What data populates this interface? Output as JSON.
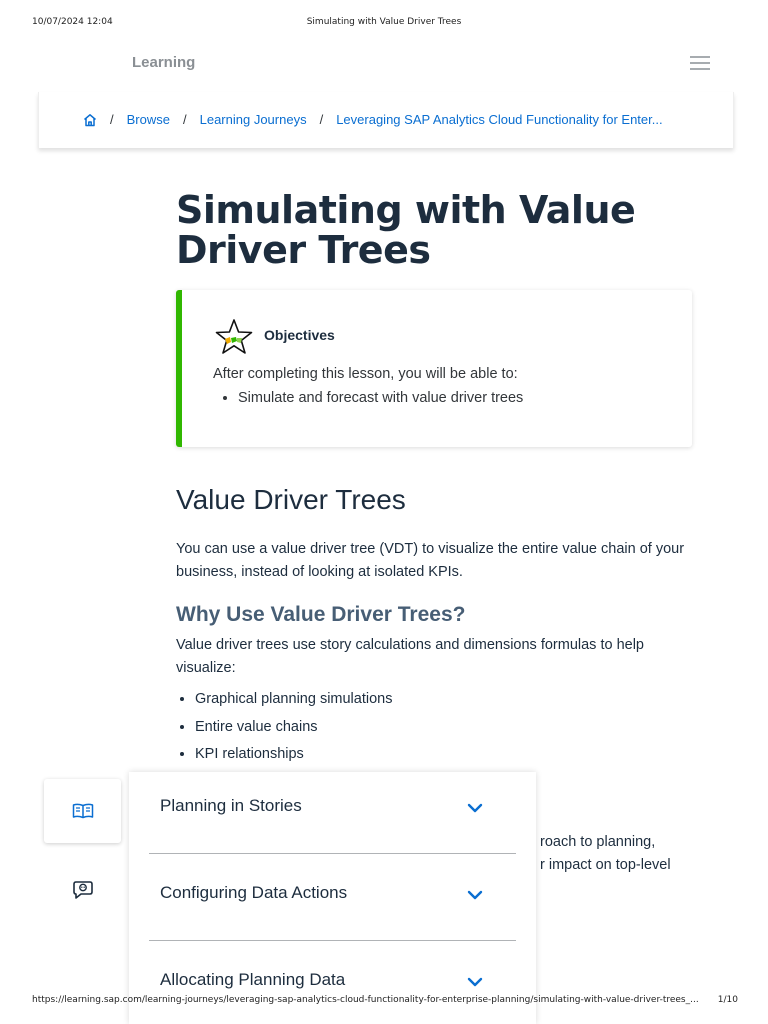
{
  "print_header": {
    "datetime": "10/07/2024 12:04",
    "doc_title": "Simulating with Value Driver Trees"
  },
  "site": {
    "brand": "Learning"
  },
  "breadcrumb": {
    "items": [
      "Browse",
      "Learning Journeys",
      "Leveraging SAP Analytics Cloud Functionality for Enter..."
    ]
  },
  "page": {
    "title": "Simulating with Value Driver Trees"
  },
  "objectives": {
    "title": "Objectives",
    "intro": "After completing this lesson, you will be able to:",
    "items": [
      "Simulate and forecast with value driver trees"
    ]
  },
  "section": {
    "heading": "Value Driver Trees",
    "paragraph": "You can use a value driver tree (VDT) to visualize the entire value chain of your business, instead of looking at isolated KPIs.",
    "subheading": "Why Use Value Driver Trees?",
    "subparagraph": "Value driver trees use story calculations and dimensions formulas to help visualize:",
    "bullets": [
      "Graphical planning simulations",
      "Entire value chains",
      "KPI relationships"
    ],
    "partial_lines": [
      "roach to planning,",
      "r impact on top-level"
    ]
  },
  "accordion": {
    "items": [
      "Planning in Stories",
      "Configuring Data Actions",
      "Allocating Planning Data"
    ]
  },
  "print_footer": {
    "url": "https://learning.sap.com/learning-journeys/leveraging-sap-analytics-cloud-functionality-for-enterprise-planning/simulating-with-value-driver-trees_...",
    "page": "1/10"
  },
  "colors": {
    "link": "#0a6ed1",
    "objective_accent": "#30b700",
    "heading": "#1d2d3e",
    "subheading": "#475e75"
  },
  "icons": [
    "home-icon",
    "star-icon",
    "book-icon",
    "chat-bot-icon",
    "chevron-down-icon",
    "hamburger-menu-icon"
  ]
}
